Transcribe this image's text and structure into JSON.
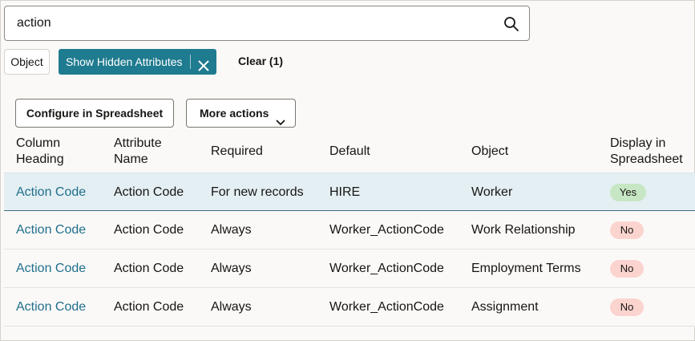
{
  "search": {
    "value": "action",
    "icon": "search-icon"
  },
  "filters": {
    "object_chip": "Object",
    "hidden_chip": "Show Hidden Attributes",
    "clear": "Clear (1)"
  },
  "toolbar": {
    "configure": "Configure in Spreadsheet",
    "more_actions": "More actions"
  },
  "table": {
    "headers": {
      "column_heading": [
        "Column",
        "Heading"
      ],
      "attribute_name": [
        "Attribute",
        "Name"
      ],
      "required": "Required",
      "default": "Default",
      "object": "Object",
      "display": [
        "Display in",
        "Spreadsheet"
      ]
    },
    "rows": [
      {
        "column_heading": "Action Code",
        "attribute_name": "Action Code",
        "required": "For new records",
        "default": "HIRE",
        "object": "Worker",
        "display": "Yes"
      },
      {
        "column_heading": "Action Code",
        "attribute_name": "Action Code",
        "required": "Always",
        "default": "Worker_ActionCode",
        "object": "Work Relationship",
        "display": "No"
      },
      {
        "column_heading": "Action Code",
        "attribute_name": "Action Code",
        "required": "Always",
        "default": "Worker_ActionCode",
        "object": "Employment Terms",
        "display": "No"
      },
      {
        "column_heading": "Action Code",
        "attribute_name": "Action Code",
        "required": "Always",
        "default": "Worker_ActionCode",
        "object": "Assignment",
        "display": "No"
      }
    ]
  },
  "colors": {
    "accent": "#1f7b8f",
    "link": "#1f6f8b",
    "yes_badge": "#c7e6c3",
    "no_badge": "#fbd4cf",
    "selected_row": "#e4eff3"
  }
}
